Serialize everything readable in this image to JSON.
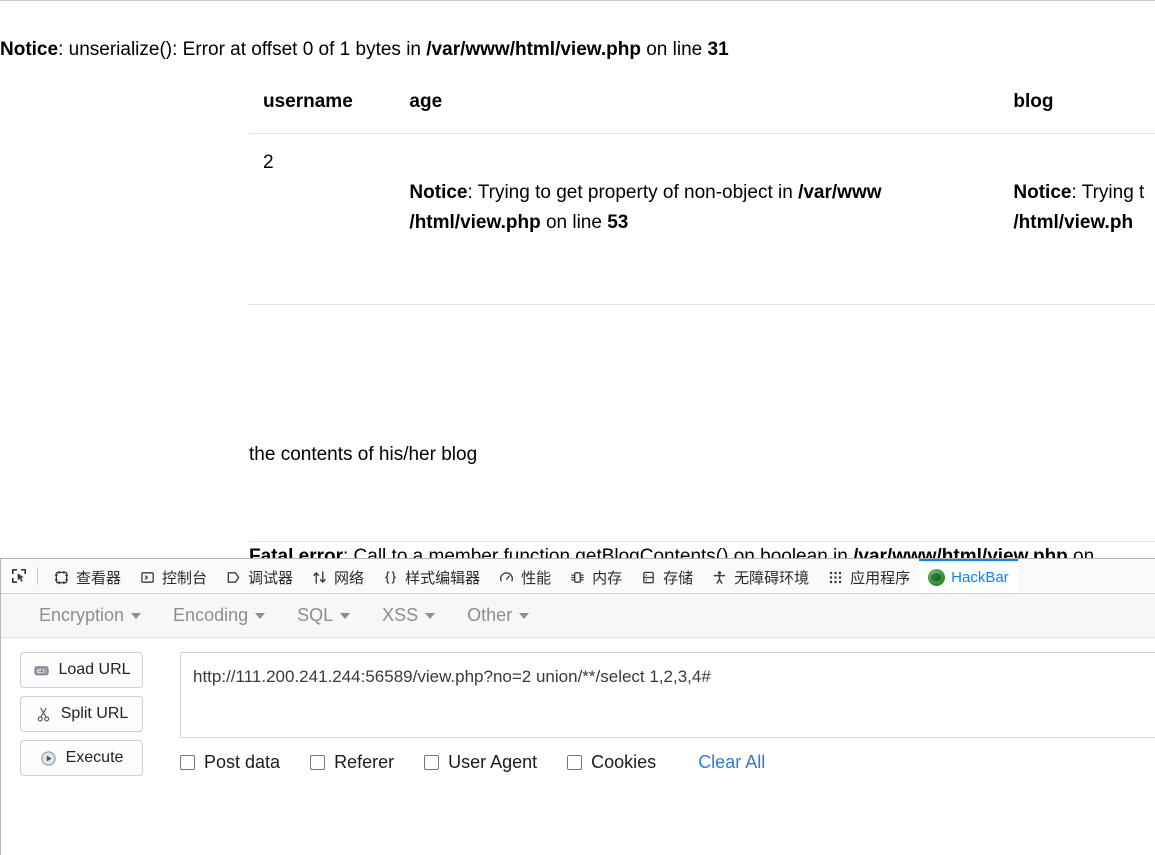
{
  "page": {
    "notice_top": {
      "label": "Notice",
      "text": ": unserialize(): Error at offset 0 of 1 bytes in ",
      "file": "/var/www/html/view.php",
      "on_line": " on line ",
      "line": "31"
    },
    "table": {
      "headers": [
        "username",
        "age",
        "blog"
      ],
      "row1": {
        "username": "2",
        "age_notice_label": "Notice",
        "age_notice_text": ": Trying to get property of non-object in ",
        "age_file_line1": "/var/www",
        "age_file_line2": "/html/view.php",
        "age_on_line": " on line ",
        "age_line": "53",
        "blog_notice_label": "Notice",
        "blog_notice_text": ": Trying t",
        "blog_file_line2": "/html/view.ph"
      },
      "row2": {
        "blog_text": "the contents of his/her blog"
      }
    },
    "fatal": {
      "label": "Fatal error",
      "text": ": Call to a member function getBlogContents() on boolean in ",
      "file": "/var/www/html/view.php",
      "tail": " on"
    }
  },
  "devtools": {
    "picker_icon": "element-picker-icon",
    "tabs": [
      {
        "label": "查看器",
        "icon": "inspector-icon",
        "active": false
      },
      {
        "label": "控制台",
        "icon": "console-icon",
        "active": false
      },
      {
        "label": "调试器",
        "icon": "debugger-icon",
        "active": false
      },
      {
        "label": "网络",
        "icon": "network-icon",
        "active": false
      },
      {
        "label": "样式编辑器",
        "icon": "style-editor-icon",
        "active": false
      },
      {
        "label": "性能",
        "icon": "performance-icon",
        "active": false
      },
      {
        "label": "内存",
        "icon": "memory-icon",
        "active": false
      },
      {
        "label": "存储",
        "icon": "storage-icon",
        "active": false
      },
      {
        "label": "无障碍环境",
        "icon": "accessibility-icon",
        "active": false
      },
      {
        "label": "应用程序",
        "icon": "application-icon",
        "active": false
      },
      {
        "label": "HackBar",
        "icon": "hackbar-icon",
        "active": true
      }
    ],
    "active_tab_color": "#0a84ff"
  },
  "hackbar": {
    "menu": [
      {
        "label": "Encryption"
      },
      {
        "label": "Encoding"
      },
      {
        "label": "SQL"
      },
      {
        "label": "XSS"
      },
      {
        "label": "Other"
      }
    ],
    "buttons": [
      {
        "label": "Load URL",
        "icon": "load-url-icon"
      },
      {
        "label": "Split URL",
        "icon": "scissors-icon"
      },
      {
        "label": "Execute",
        "icon": "play-icon"
      }
    ],
    "url_value": "http://111.200.241.244:56589/view.php?no=2 union/**/select 1,2,3,4#",
    "url_placeholder": "",
    "options": [
      {
        "label": "Post data",
        "checked": false
      },
      {
        "label": "Referer",
        "checked": false
      },
      {
        "label": "User Agent",
        "checked": false
      },
      {
        "label": "Cookies",
        "checked": false
      }
    ],
    "clear_all_label": "Clear All",
    "link_color": "#2c7bd6"
  }
}
